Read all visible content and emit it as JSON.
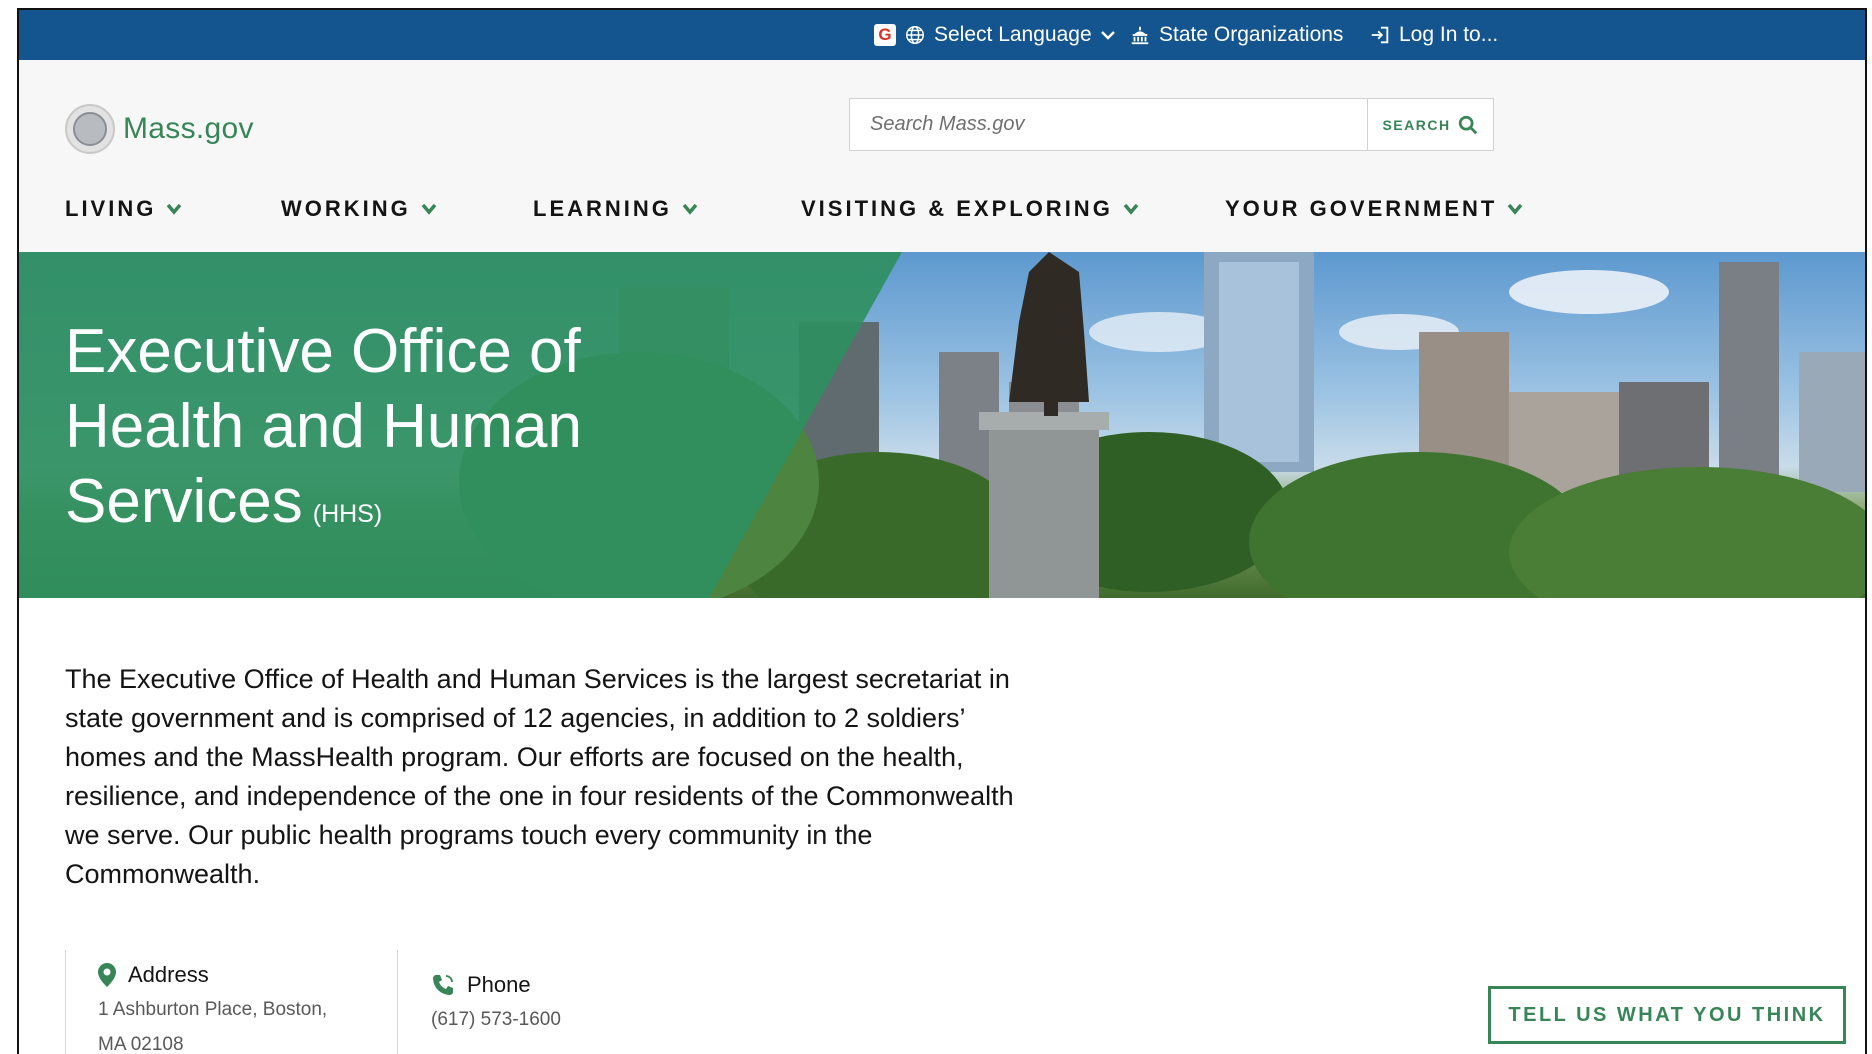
{
  "utility": {
    "language_label": "Select Language",
    "orgs_label": "State Organizations",
    "login_label": "Log In to..."
  },
  "header": {
    "logo_text": "Mass.gov",
    "search_placeholder": "Search Mass.gov",
    "search_button_label": "SEARCH"
  },
  "nav": {
    "items": [
      {
        "label": "LIVING"
      },
      {
        "label": "WORKING"
      },
      {
        "label": "LEARNING"
      },
      {
        "label": "VISITING & EXPLORING"
      },
      {
        "label": "YOUR GOVERNMENT"
      }
    ]
  },
  "hero": {
    "title": "Executive Office of Health and Human Services",
    "abbr": "(HHS)"
  },
  "intro": "The Executive Office of Health and Human Services is the largest secretariat in state government and is comprised of 12 agencies, in addition to 2 soldiers’ homes and the MassHealth program. Our efforts are focused on the health, resilience, and independence of the one in four residents of the Commonwealth we serve. Our public health programs touch every community in the Commonwealth.",
  "contact": {
    "address_label": "Address",
    "address_value": "1 Ashburton Place, Boston, MA 02108",
    "phone_label": "Phone",
    "phone_value": "(617) 573-1600"
  },
  "feedback_label": "TELL US WHAT YOU THINK",
  "colors": {
    "utility_bar": "#14558f",
    "brand_green": "#388557",
    "hero_green": "#2f8f5f"
  }
}
